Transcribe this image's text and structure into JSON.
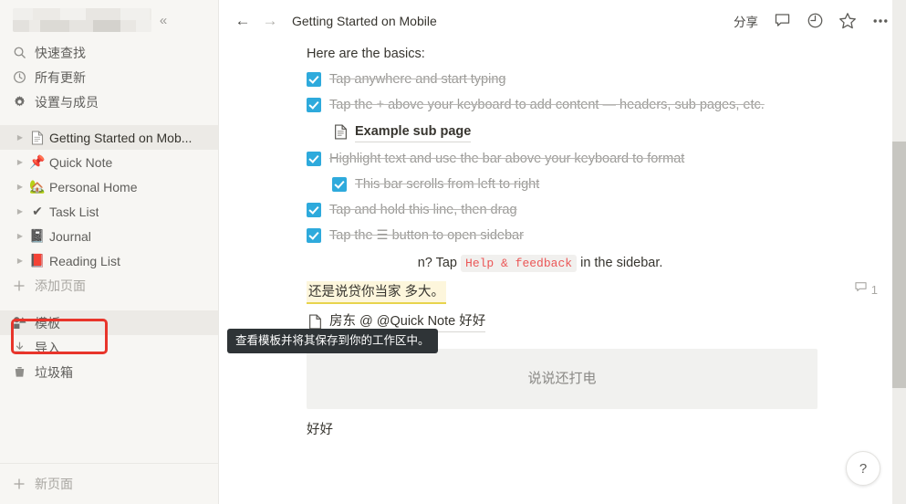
{
  "sidebar": {
    "workspace_title_blurred": "",
    "collapse_icon": "chevrons-left-icon",
    "quick_items": [
      {
        "label": "快速查找",
        "icon": "search-icon"
      },
      {
        "label": "所有更新",
        "icon": "clock-icon"
      },
      {
        "label": "设置与成员",
        "icon": "gear-icon"
      }
    ],
    "pages": [
      {
        "label": "Getting Started on Mob...",
        "emoji": "📄",
        "selected": true
      },
      {
        "label": "Quick Note",
        "emoji": "📌",
        "selected": false
      },
      {
        "label": "Personal Home",
        "emoji": "🏡",
        "selected": false
      },
      {
        "label": "Task List",
        "emoji": "✔",
        "selected": false
      },
      {
        "label": "Journal",
        "emoji": "📓",
        "selected": false
      },
      {
        "label": "Reading List",
        "emoji": "📕",
        "selected": false
      }
    ],
    "add_page": {
      "label": "添加页面",
      "icon": "plus-icon"
    },
    "bottom_items": [
      {
        "label": "模板",
        "icon": "templates-icon",
        "highlighted": true
      },
      {
        "label": "导入",
        "icon": "import-icon",
        "highlighted": false
      },
      {
        "label": "垃圾箱",
        "icon": "trash-icon",
        "highlighted": false
      }
    ],
    "footer": {
      "label": "新页面",
      "icon": "plus-icon"
    },
    "highlight_color": "#e8352b"
  },
  "tooltip": {
    "text": "查看模板并将其保存到你的工作区中。"
  },
  "topbar": {
    "back_icon": "arrow-left-icon",
    "forward_icon": "arrow-right-icon",
    "breadcrumb": "Getting Started on Mobile",
    "share_label": "分享",
    "comment_icon": "comment-icon",
    "history_icon": "clock-history-icon",
    "favorite_icon": "star-icon",
    "more_icon": "ellipsis-icon"
  },
  "document": {
    "intro": "Here are the basics:",
    "todos": [
      {
        "text": "Tap anywhere and start typing",
        "checked": true,
        "indent": 0
      },
      {
        "text": "Tap the + above your keyboard to add content — headers, sub pages, etc.",
        "checked": true,
        "indent": 0
      },
      {
        "text": "Highlight text and use the bar above your keyboard to format",
        "checked": true,
        "indent": 0
      },
      {
        "text": "This bar scrolls from left to right",
        "checked": true,
        "indent": 1
      },
      {
        "text": "Tap and hold this line, then drag",
        "checked": true,
        "indent": 0
      },
      {
        "text": "Tap the ☰ button to open sidebar",
        "checked": true,
        "indent": 0
      }
    ],
    "sub_page": {
      "label": "Example sub page",
      "icon": "page-icon"
    },
    "help_line": {
      "prefix": "n? Tap",
      "code": "Help & feedback",
      "suffix": "in the sidebar."
    },
    "highlighted_line": {
      "text": "还是说贷你当家 多大。",
      "comment_count": "1",
      "highlight_bg": "#fdf6dc"
    },
    "mention_line": {
      "text": "房东 @ @Quick Note 好好",
      "icon": "page-icon"
    },
    "gray_block_text": "说说还打电",
    "tail_text": "好好"
  },
  "help_fab": {
    "label": "?"
  }
}
